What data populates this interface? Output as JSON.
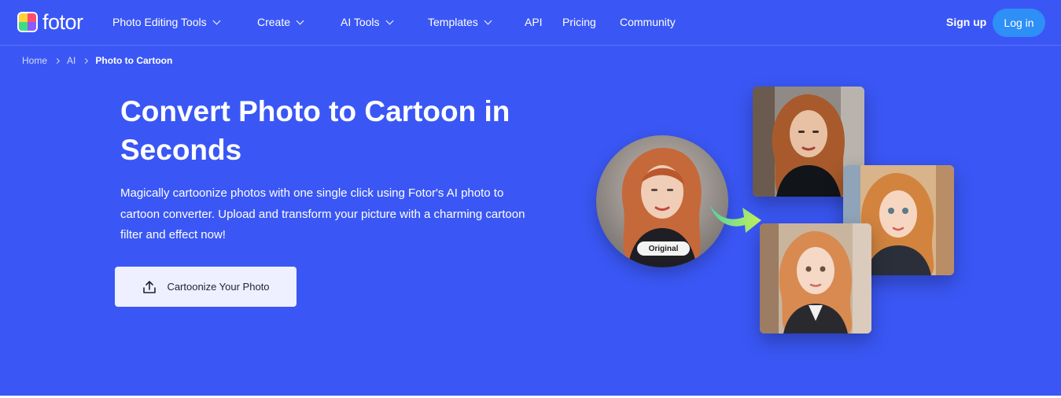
{
  "brand": {
    "name": "fotor"
  },
  "nav": {
    "items": [
      {
        "label": "Photo Editing Tools",
        "dropdown": true
      },
      {
        "label": "Create",
        "dropdown": true
      },
      {
        "label": "AI Tools",
        "dropdown": true
      },
      {
        "label": "Templates",
        "dropdown": true
      },
      {
        "label": "API",
        "dropdown": false
      },
      {
        "label": "Pricing",
        "dropdown": false
      },
      {
        "label": "Community",
        "dropdown": false
      }
    ],
    "signup_label": "Sign up",
    "login_label": "Log in"
  },
  "breadcrumb": {
    "items": [
      "Home",
      "AI"
    ],
    "current": "Photo to Cartoon"
  },
  "hero": {
    "title": "Convert Photo to Cartoon in Seconds",
    "description": "Magically cartoonize photos with one single click using Fotor's AI photo to cartoon converter. Upload and transform your picture with a charming cartoon filter and effect now!",
    "cta_label": "Cartoonize Your Photo"
  },
  "visual": {
    "original_label": "Original"
  },
  "colors": {
    "background": "#3a57f5",
    "login_button": "#2e8ff7",
    "cta_background": "#eef0ff",
    "arrow_gradient": [
      "#4fd1a5",
      "#c6f35a"
    ]
  },
  "icons": {
    "nav_dropdown": "chevron-down-icon",
    "breadcrumb_separator": "chevron-right-icon",
    "cta": "upload-icon"
  }
}
